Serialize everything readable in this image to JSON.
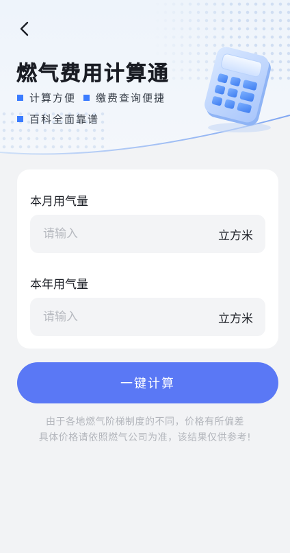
{
  "header": {
    "title": "燃气费用计算通",
    "features": [
      "计算方便",
      "缴费查询便捷",
      "百科全面靠谱"
    ],
    "accent_color": "#3b7cff"
  },
  "form": {
    "monthly": {
      "label": "本月用气量",
      "placeholder": "请输入",
      "value": "",
      "unit": "立方米"
    },
    "yearly": {
      "label": "本年用气量",
      "placeholder": "请输入",
      "value": "",
      "unit": "立方米"
    }
  },
  "action": {
    "calculate_label": "一键计算",
    "color": "#5a78f5"
  },
  "disclaimer": {
    "line1": "由于各地燃气阶梯制度的不同，价格有所偏差",
    "line2": "具体价格请依照燃气公司为准，该结果仅供参考!"
  }
}
